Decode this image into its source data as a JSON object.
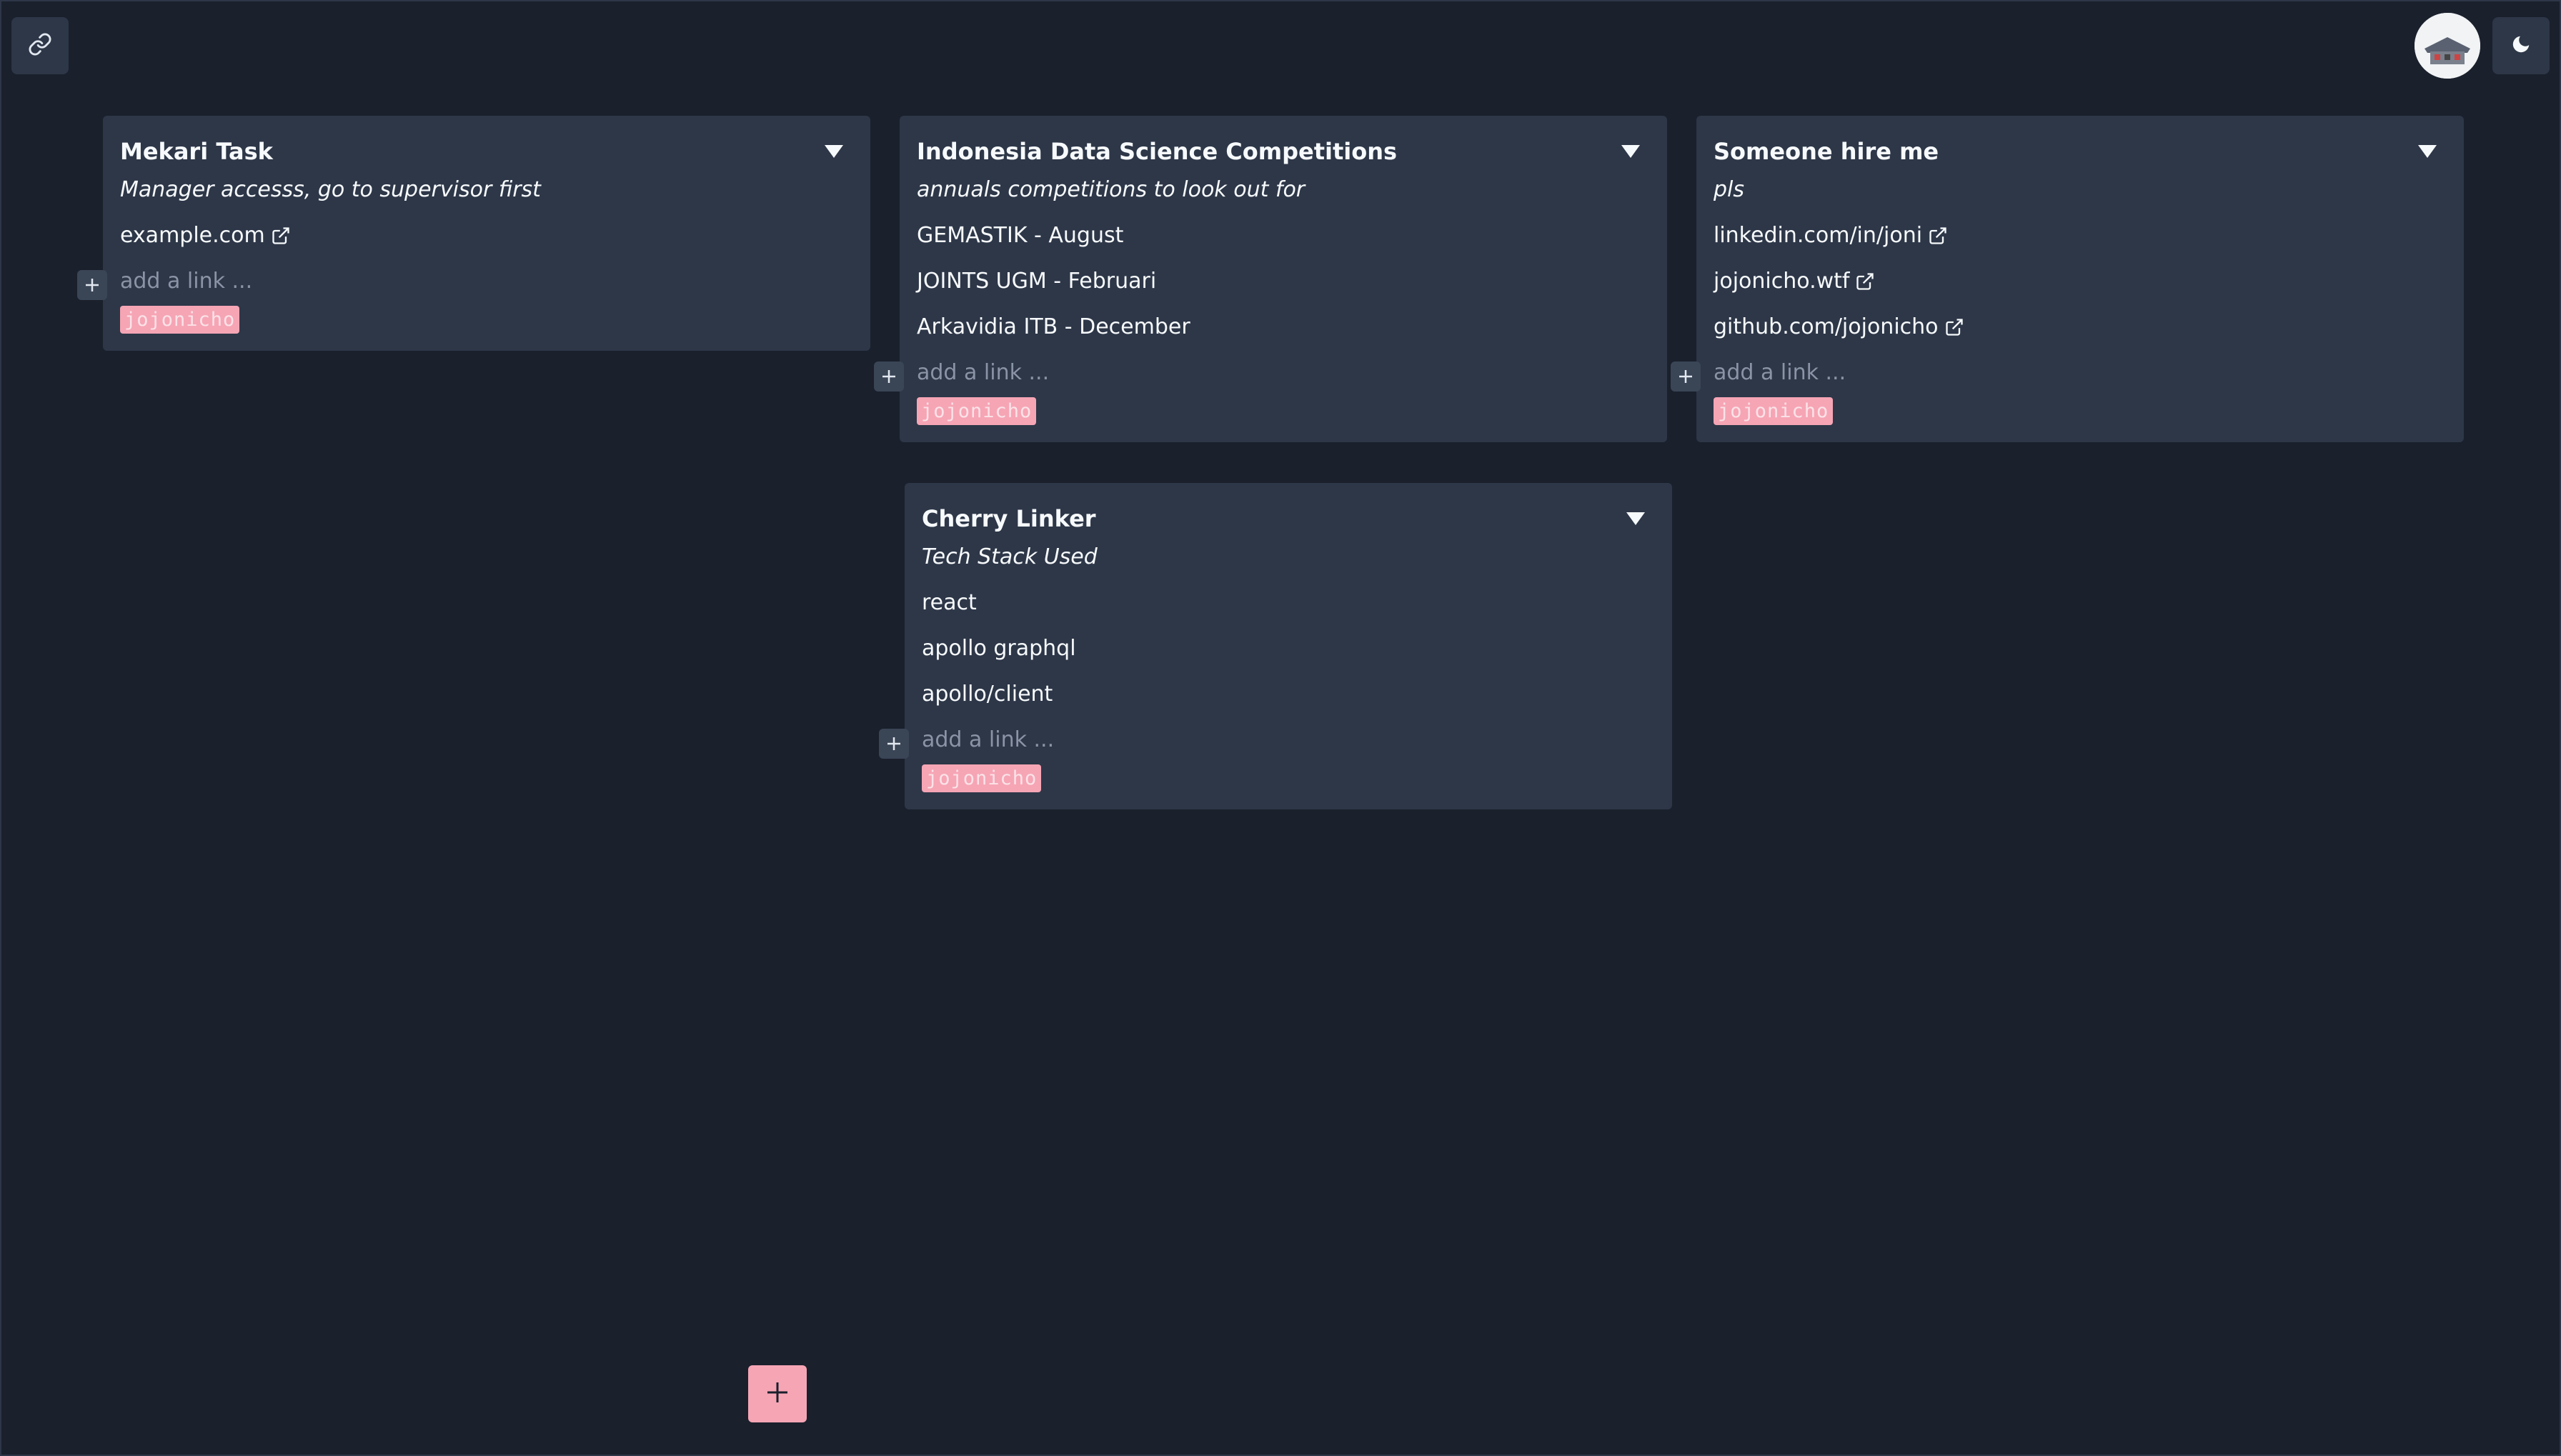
{
  "colors": {
    "background": "#1a202c",
    "card": "#2d3748",
    "accent_pink": "#f6a5b5",
    "text": "#f7fafc",
    "muted": "#8a94a6"
  },
  "topbar": {
    "link_icon": "link-icon",
    "avatar": "avatar",
    "theme_icon": "moon-icon"
  },
  "add_link_placeholder": "add a link ...",
  "cards": [
    {
      "title": "Mekari Task",
      "description": "Manager accesss, go to supervisor first",
      "links": [
        {
          "text": "example.com",
          "external": true
        }
      ],
      "tag": "jojonicho"
    },
    {
      "title": "Indonesia Data Science Competitions",
      "description": "annuals competitions to look out for",
      "links": [
        {
          "text": "GEMASTIK - August",
          "external": false
        },
        {
          "text": "JOINTS UGM - Februari",
          "external": false
        },
        {
          "text": "Arkavidia ITB - December",
          "external": false
        }
      ],
      "tag": "jojonicho"
    },
    {
      "title": "Someone hire me",
      "description": "pls",
      "links": [
        {
          "text": "linkedin.com/in/joni",
          "external": true
        },
        {
          "text": "jojonicho.wtf",
          "external": true
        },
        {
          "text": "github.com/jojonicho",
          "external": true
        }
      ],
      "tag": "jojonicho"
    },
    {
      "title": "Cherry Linker",
      "description": "Tech Stack Used",
      "links": [
        {
          "text": "react",
          "external": false
        },
        {
          "text": "apollo graphql",
          "external": false
        },
        {
          "text": "apollo/client",
          "external": false
        }
      ],
      "tag": "jojonicho"
    }
  ],
  "fab": {
    "icon": "plus-icon"
  }
}
